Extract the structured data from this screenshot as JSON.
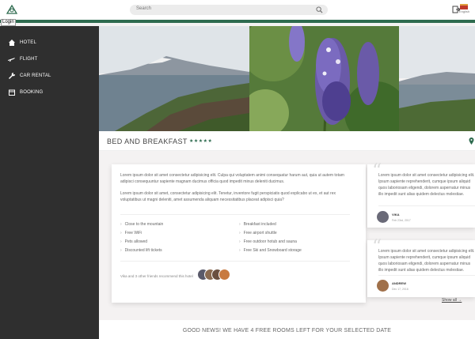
{
  "search": {
    "placeholder": "Search"
  },
  "header": {
    "login_label": "Login",
    "flag_label": "English"
  },
  "sidebar": {
    "items": [
      {
        "label": "HOTEL",
        "icon": "home-icon"
      },
      {
        "label": "FLIGHT",
        "icon": "plane-icon"
      },
      {
        "label": "CAR RENTAL",
        "icon": "wrench-icon"
      },
      {
        "label": "BOOKING",
        "icon": "calendar-icon"
      }
    ]
  },
  "hotel": {
    "title": "BED AND BREAKFAST",
    "stars": "★★★★★",
    "description": [
      "Lorem ipsum dolor sit amet consectetur adipisicing elit. Culpa qui voluptatem animi consequatur harum aut, quia ut autem totam adipisci consequuntur sapiente magnam ducimus officia quod impedit minus deleniti ducimus.",
      "Lorem ipsum dolor sit amet, consectetur adipisicing elit. Tenetur, inventore fugit perspiciatis quod explicabo ut ex, et aut rex voluptatibus ut magni deleniti, amet assumenda aliquam necessitatibus placeat adipisci quia?"
    ],
    "features_left": [
      "Close to the mountain",
      "Free WiFi",
      "Pets allowed",
      "Discounted lift tickets"
    ],
    "features_right": [
      "Breakfast included",
      "Free airport shuttle",
      "Free outdoor hotub and sauna",
      "Free Ski and Snowboard storage"
    ],
    "recommend": "Vika and 3 other friends recommend this hotel"
  },
  "reviews": [
    {
      "text": "Lorem ipsum dolor sit amet consectetur adipisicing elit. Ipsum sapiente reprehenderit, cumque ipsum aliquid quos laboriosam eligendi, dolorem aspernatur minus illo impedit sunt alias quidem delectus molestiae.",
      "name": "VIKA",
      "date": "Feb 23rd, 2017"
    },
    {
      "text": "Lorem ipsum dolor sit amet consectetur adipisicing elit. Ipsum sapiente reprehenderit, cumque ipsum aliquid quos laboriosam eligendi, dolorem aspernatur minus illo impedit sunt alias quidem delectus molestiae.",
      "name": "ANDREW",
      "date": "Dec 17, 2016"
    }
  ],
  "show_all": "Show all →",
  "news": "GOOD NEWS! WE HAVE 4 FREE ROOMS LEFT FOR YOUR SELECTED DATE",
  "colors": {
    "accent": "#2e6b4f",
    "sidebar": "#2f2f2f"
  }
}
